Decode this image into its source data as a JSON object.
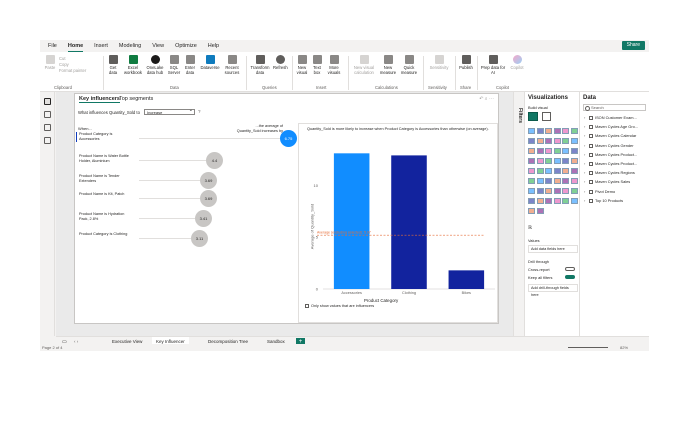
{
  "menu": {
    "items": [
      "File",
      "Home",
      "Insert",
      "Modeling",
      "View",
      "Optimize",
      "Help"
    ],
    "active": "Home",
    "share": "Share"
  },
  "ribbon": {
    "clipboard": {
      "paste": "Paste",
      "cut": "Cut",
      "copy": "Copy",
      "format_painter": "Format painter",
      "group": "Clipboard"
    },
    "data": {
      "items": [
        "Get data",
        "Excel workbook",
        "OneLake data hub",
        "SQL Server",
        "Enter data",
        "Dataverse",
        "Recent sources"
      ],
      "group": "Data"
    },
    "queries": {
      "items": [
        "Transform data",
        "Refresh"
      ],
      "group": "Queries"
    },
    "insert": {
      "items": [
        "New visual",
        "Text box",
        "More visuals"
      ],
      "group": "Insert"
    },
    "calculations": {
      "items": [
        "New visual calculation",
        "New measure",
        "Quick measure"
      ],
      "group": "Calculations"
    },
    "sensitivity": {
      "items": [
        "Sensitivity"
      ],
      "group": "Sensitivity"
    },
    "share": {
      "items": [
        "Publish"
      ],
      "group": "Share"
    },
    "copilot": {
      "items": [
        "Prep data for AI",
        "Copilot"
      ],
      "group": "Copilot"
    }
  },
  "visual": {
    "tabs": [
      "Key influencers",
      "Top segments"
    ],
    "question": "What influences Quantity_Sold to",
    "dropdown": "Increase",
    "help": "?",
    "when": "When...",
    "avg_header": "...the average of Quantity_Sold increases by",
    "influencers": [
      {
        "label": "Product Category is Accessories",
        "value": "6.75"
      },
      {
        "label": "Product Name is Water Bottle Holder, Aluminium",
        "value": "4.4"
      },
      {
        "label": "Product Name is Tender Extenders",
        "value": "3.69"
      },
      {
        "label": "Product Name is Kit, Patch",
        "value": "3.69"
      },
      {
        "label": "Product Name is Hydration Pack, 2.8%",
        "value": "3.41"
      },
      {
        "label": "Product Category is Clothing",
        "value": "3.11"
      }
    ],
    "chart_title": "Quantity_Sold is more likely to increase when Product Category is Accessories than otherwise (on average).",
    "checkbox": "Only show values that are influencers"
  },
  "chart_data": {
    "type": "bar",
    "categories": [
      "Accessories",
      "Clothing",
      "Bikes"
    ],
    "values": [
      13.1,
      12.9,
      1.8
    ],
    "colors": [
      "#118dff",
      "#12239e",
      "#12239e"
    ],
    "xlabel": "Product Category",
    "ylabel": "Average of Quantity_Sold",
    "ylim": [
      0,
      14
    ],
    "yticks": [
      0,
      5,
      10
    ],
    "reference_line": {
      "value": 5.2,
      "label": "Average (excluding selected): 5.97"
    }
  },
  "pages": {
    "tabs": [
      "Executive View",
      "Key Influencer",
      "Decomposition Tree",
      "Sandbox"
    ],
    "active": "Key Influencer",
    "add": "+"
  },
  "status": {
    "page": "Page 2 of 4",
    "zoom": "82%"
  },
  "filters": {
    "label": "Filters"
  },
  "viz_pane": {
    "title": "Visualizations",
    "build": "Build visual",
    "values": "Values",
    "add_fields": "Add data fields here",
    "drill": "Drill through",
    "cross_report": "Cross-report",
    "keep_filters": "Keep all filters",
    "add_drill": "Add drill-through fields here"
  },
  "data_pane": {
    "title": "Data",
    "search": "Search",
    "tables": [
      "ISON Customer Exam...",
      "Maven Cycles Age Gro...",
      "Maven Cycles Calendar",
      "Maven Cycles Gender",
      "Maven Cycles Product...",
      "Maven Cycles Product...",
      "Maven Cycles Regions",
      "Maven Cycles Sales",
      "Pivot Demo",
      "Top 10 Products"
    ]
  }
}
